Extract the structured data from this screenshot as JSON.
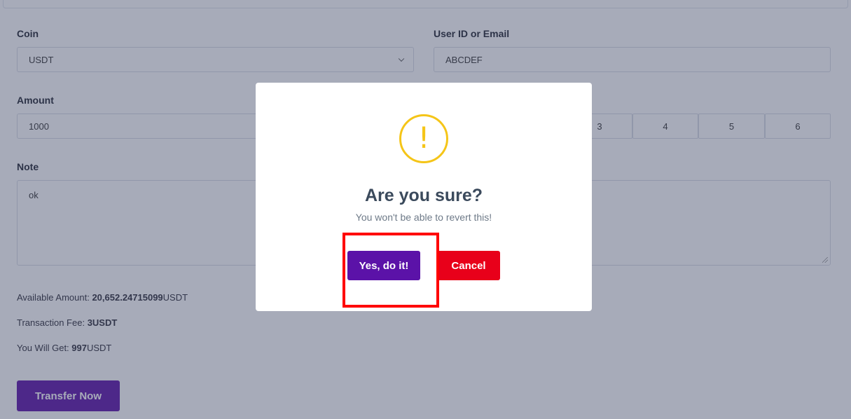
{
  "form": {
    "coin": {
      "label": "Coin",
      "value": "USDT"
    },
    "user": {
      "label": "User ID or Email",
      "value": "ABCDEF"
    },
    "amount": {
      "label": "Amount",
      "value": "1000"
    },
    "percent_buttons": [
      "3",
      "4",
      "5",
      "6"
    ],
    "note": {
      "label": "Note",
      "value": "ok"
    },
    "available": {
      "prefix": "Available Amount: ",
      "value": "20,652.24715099",
      "unit": "USDT"
    },
    "fee": {
      "prefix": "Transaction Fee: ",
      "value": "3USDT"
    },
    "receive": {
      "prefix": "You Will Get: ",
      "value": "997",
      "unit": "USDT"
    },
    "submit_label": "Transfer Now"
  },
  "modal": {
    "icon": "exclamation-icon",
    "icon_glyph": "!",
    "title": "Are you sure?",
    "text": "You won't be able to revert this!",
    "confirm_label": "Yes, do it!",
    "cancel_label": "Cancel"
  },
  "colors": {
    "primary": "#5b12a8",
    "danger": "#e8001a",
    "warning": "#f5c518",
    "highlight": "#ff0000"
  }
}
